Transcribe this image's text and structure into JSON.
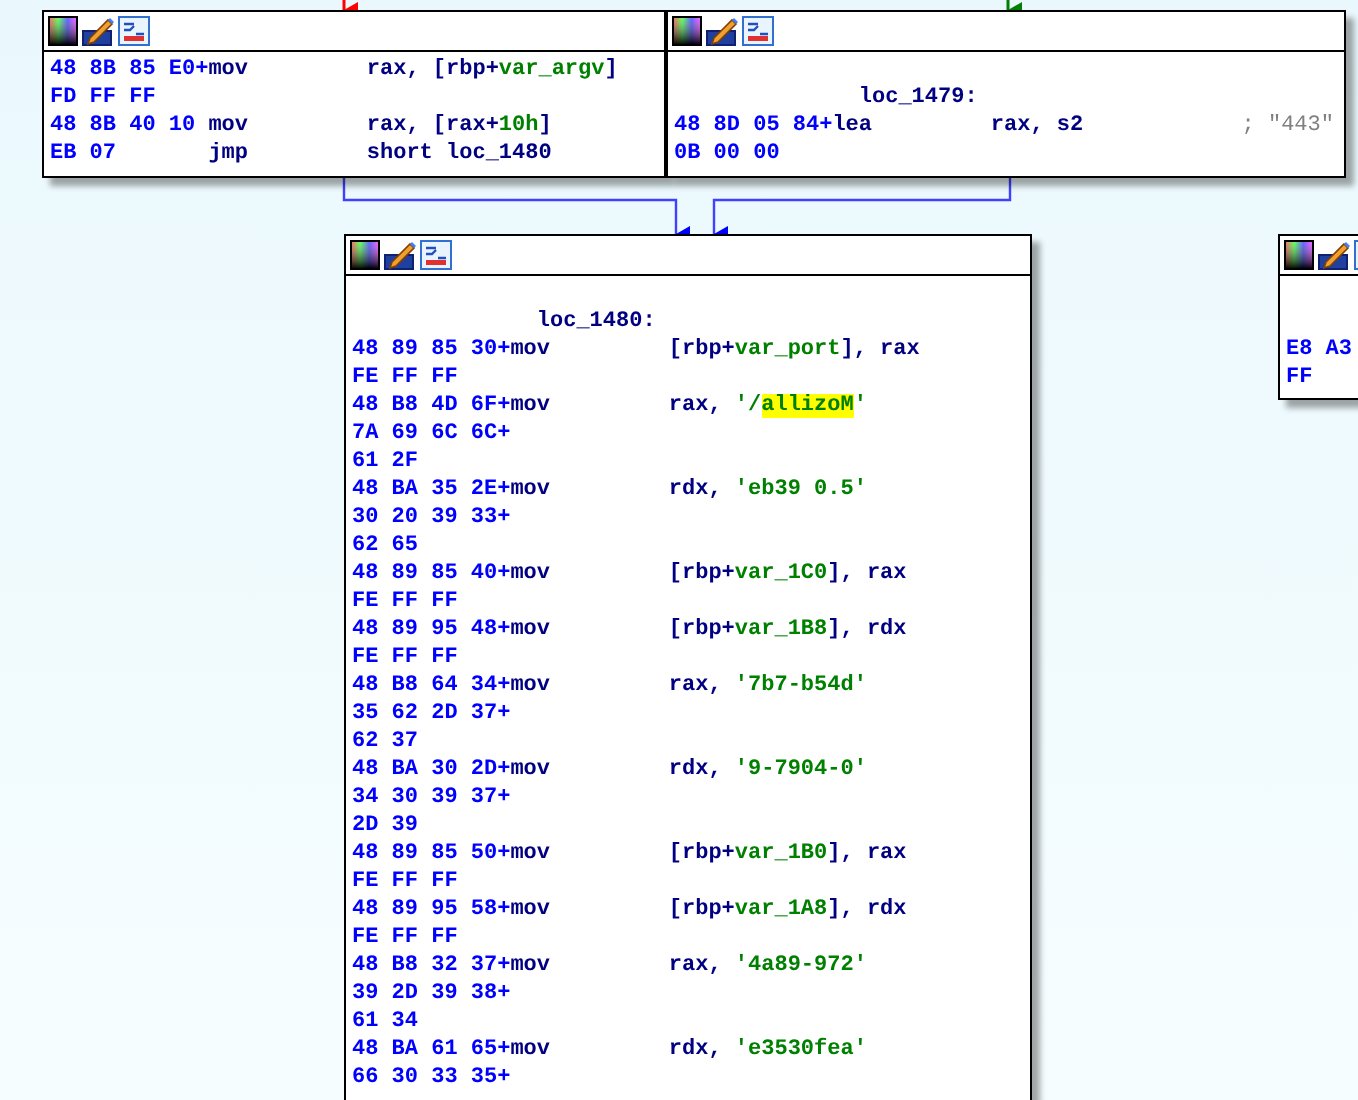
{
  "nodes": [
    {
      "lines": [
        {
          "kind": "insn",
          "bytes": "48 8B 85 E0+",
          "mnemonic": "mov",
          "operands": [
            {
              "kind": "plain",
              "text": "rax, [rbp+"
            },
            {
              "kind": "name",
              "text": "var_argv"
            },
            {
              "kind": "plain",
              "text": "]"
            }
          ]
        },
        {
          "kind": "bytes",
          "bytes": "FD FF FF"
        },
        {
          "kind": "insn",
          "bytes": "48 8B 40 10 ",
          "mnemonic": "mov",
          "operands": [
            {
              "kind": "plain",
              "text": "rax, [rax+"
            },
            {
              "kind": "name",
              "text": "10h"
            },
            {
              "kind": "plain",
              "text": "]"
            }
          ]
        },
        {
          "kind": "insn",
          "bytes": "EB 07",
          "mnemonic": "jmp",
          "operands": [
            {
              "kind": "plain",
              "text": "short loc_1480"
            }
          ]
        }
      ]
    },
    {
      "lines": [
        {
          "kind": "label",
          "text": "loc_1479:"
        },
        {
          "kind": "insn",
          "bytes": "48 8D 05 84+",
          "mnemonic": "lea",
          "operands": [
            {
              "kind": "plain",
              "text": "rax, s2"
            }
          ],
          "comment": "; \"443\""
        },
        {
          "kind": "bytes",
          "bytes": "0B 00 00"
        }
      ]
    },
    {
      "lines": [
        {
          "kind": "label",
          "text": "loc_1480:"
        },
        {
          "kind": "insn",
          "bytes": "48 89 85 30+",
          "mnemonic": "mov",
          "operands": [
            {
              "kind": "plain",
              "text": "[rbp+"
            },
            {
              "kind": "name",
              "text": "var_port"
            },
            {
              "kind": "plain",
              "text": "], rax"
            }
          ]
        },
        {
          "kind": "bytes",
          "bytes": "FE FF FF"
        },
        {
          "kind": "insn",
          "bytes": "48 B8 4D 6F+",
          "mnemonic": "mov",
          "operands": [
            {
              "kind": "plain",
              "text": "rax, "
            },
            {
              "kind": "name",
              "text": "'/"
            },
            {
              "kind": "highlight",
              "text": "allizoM"
            },
            {
              "kind": "name",
              "text": "'"
            }
          ]
        },
        {
          "kind": "bytes",
          "bytes": "7A 69 6C 6C+"
        },
        {
          "kind": "bytes",
          "bytes": "61 2F"
        },
        {
          "kind": "insn",
          "bytes": "48 BA 35 2E+",
          "mnemonic": "mov",
          "operands": [
            {
              "kind": "plain",
              "text": "rdx, "
            },
            {
              "kind": "name",
              "text": "'eb39 0.5'"
            }
          ]
        },
        {
          "kind": "bytes",
          "bytes": "30 20 39 33+"
        },
        {
          "kind": "bytes",
          "bytes": "62 65"
        },
        {
          "kind": "insn",
          "bytes": "48 89 85 40+",
          "mnemonic": "mov",
          "operands": [
            {
              "kind": "plain",
              "text": "[rbp+"
            },
            {
              "kind": "name",
              "text": "var_1C0"
            },
            {
              "kind": "plain",
              "text": "], rax"
            }
          ]
        },
        {
          "kind": "bytes",
          "bytes": "FE FF FF"
        },
        {
          "kind": "insn",
          "bytes": "48 89 95 48+",
          "mnemonic": "mov",
          "operands": [
            {
              "kind": "plain",
              "text": "[rbp+"
            },
            {
              "kind": "name",
              "text": "var_1B8"
            },
            {
              "kind": "plain",
              "text": "], rdx"
            }
          ]
        },
        {
          "kind": "bytes",
          "bytes": "FE FF FF"
        },
        {
          "kind": "insn",
          "bytes": "48 B8 64 34+",
          "mnemonic": "mov",
          "operands": [
            {
              "kind": "plain",
              "text": "rax, "
            },
            {
              "kind": "name",
              "text": "'7b7-b54d'"
            }
          ]
        },
        {
          "kind": "bytes",
          "bytes": "35 62 2D 37+"
        },
        {
          "kind": "bytes",
          "bytes": "62 37"
        },
        {
          "kind": "insn",
          "bytes": "48 BA 30 2D+",
          "mnemonic": "mov",
          "operands": [
            {
              "kind": "plain",
              "text": "rdx, "
            },
            {
              "kind": "name",
              "text": "'9-7904-0'"
            }
          ]
        },
        {
          "kind": "bytes",
          "bytes": "34 30 39 37+"
        },
        {
          "kind": "bytes",
          "bytes": "2D 39"
        },
        {
          "kind": "insn",
          "bytes": "48 89 85 50+",
          "mnemonic": "mov",
          "operands": [
            {
              "kind": "plain",
              "text": "[rbp+"
            },
            {
              "kind": "name",
              "text": "var_1B0"
            },
            {
              "kind": "plain",
              "text": "], rax"
            }
          ]
        },
        {
          "kind": "bytes",
          "bytes": "FE FF FF"
        },
        {
          "kind": "insn",
          "bytes": "48 89 95 58+",
          "mnemonic": "mov",
          "operands": [
            {
              "kind": "plain",
              "text": "[rbp+"
            },
            {
              "kind": "name",
              "text": "var_1A8"
            },
            {
              "kind": "plain",
              "text": "], rdx"
            }
          ]
        },
        {
          "kind": "bytes",
          "bytes": "FE FF FF"
        },
        {
          "kind": "insn",
          "bytes": "48 B8 32 37+",
          "mnemonic": "mov",
          "operands": [
            {
              "kind": "plain",
              "text": "rax, "
            },
            {
              "kind": "name",
              "text": "'4a89-972'"
            }
          ]
        },
        {
          "kind": "bytes",
          "bytes": "39 2D 39 38+"
        },
        {
          "kind": "bytes",
          "bytes": "61 34"
        },
        {
          "kind": "insn",
          "bytes": "48 BA 61 65+",
          "mnemonic": "mov",
          "operands": [
            {
              "kind": "plain",
              "text": "rdx, "
            },
            {
              "kind": "name",
              "text": "'e3530fea'"
            }
          ]
        },
        {
          "kind": "bytes",
          "bytes": "66 30 33 35+"
        }
      ]
    },
    {
      "lines": [
        {
          "kind": "bytes",
          "bytes": "E8 A3"
        },
        {
          "kind": "bytes",
          "bytes": "FF"
        }
      ]
    }
  ]
}
